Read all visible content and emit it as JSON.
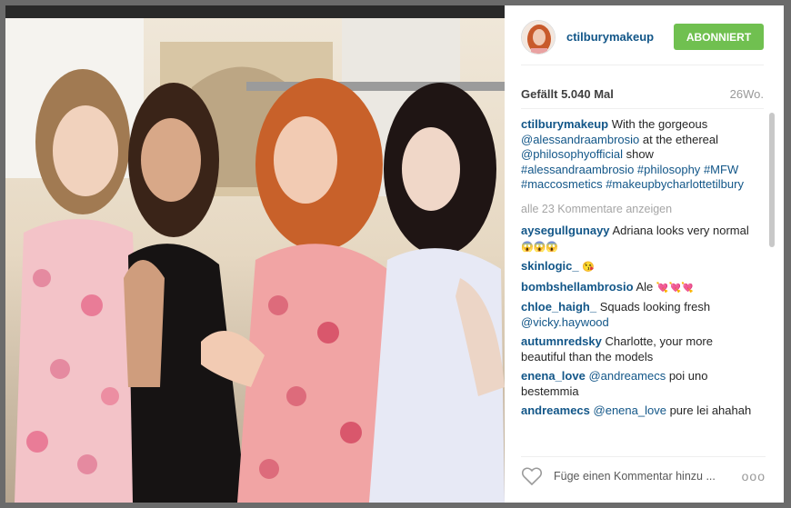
{
  "post": {
    "username": "ctilburymakeup",
    "follow_label": "ABONNIERT",
    "likes": "Gefällt 5.040 Mal",
    "age": "26Wo."
  },
  "caption": {
    "user": "ctilburymakeup",
    "text_1": "With the gorgeous",
    "mention": "@alessandraambrosio",
    "text_2": "at the ethereal",
    "mention_2": "@philosophyofficial",
    "text_3": "show",
    "tags": [
      "#alessandraambrosio",
      "#philosophy",
      "#MFW",
      "#maccosmetics",
      "#makeupbycharlottetilbury"
    ]
  },
  "more_comments": "alle 23 Kommentare anzeigen",
  "comments": [
    {
      "user": "aysegullgunayy",
      "text": "Adriana looks very normal",
      "emoji": "😱😱😱"
    },
    {
      "user": "skinlogic_",
      "text": "",
      "emoji": "😘"
    },
    {
      "user": "bombshellambrosio",
      "text": "Ale",
      "emoji": "💘💘💘"
    },
    {
      "user": "chloe_haigh_",
      "text": "Squads looking fresh",
      "mention": "@vicky.haywood"
    },
    {
      "user": "autumnredsky",
      "text": "Charlotte, your more beautiful than the models"
    },
    {
      "user": "enena_love",
      "text": "poi uno bestemmia",
      "mention_before": "@andreamecs"
    },
    {
      "user": "andreamecs",
      "text": "pure lei ahahah",
      "mention_before": "@enena_love"
    }
  ],
  "footer": {
    "placeholder": "Füge einen Kommentar hinzu ...",
    "more_icon": "ooo"
  },
  "colors": {
    "link": "#125688",
    "follow": "#70c050",
    "backdrop": "#6b6b6b"
  }
}
